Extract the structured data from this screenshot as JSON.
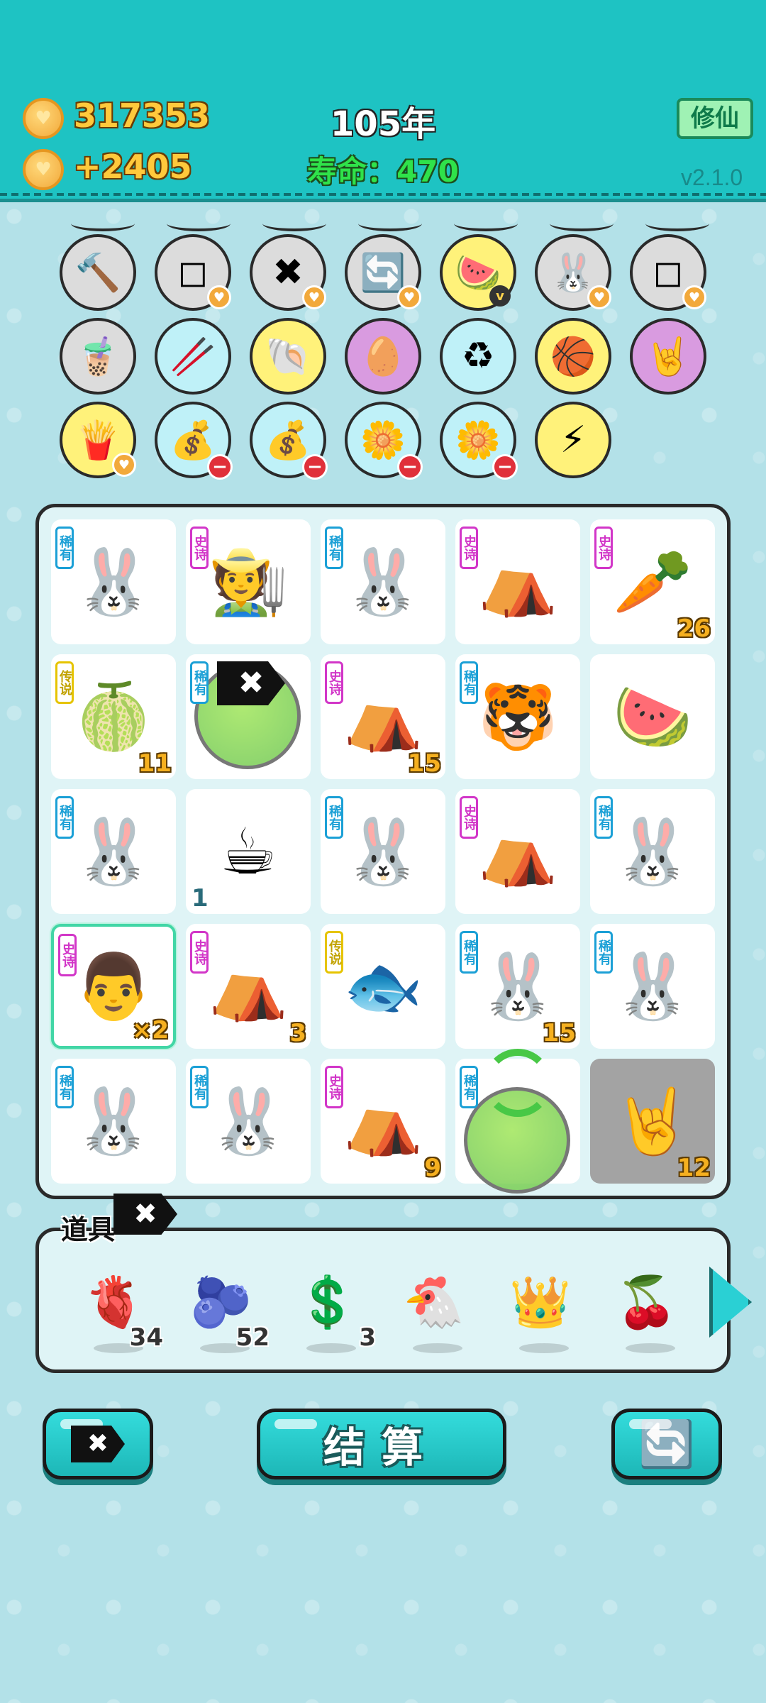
{
  "header": {
    "coins": "317353",
    "coins_per_turn": "+2405",
    "year": "105年",
    "lifespan": "寿命：470",
    "xiuxian_button": "修仙",
    "version": "v2.1.0"
  },
  "round_items": [
    {
      "name": "hammer-icon",
      "glyph": "🔨",
      "color": "gray"
    },
    {
      "name": "sugar-cubes-icon",
      "glyph": "◻",
      "color": "gray",
      "badge": "heart"
    },
    {
      "name": "remove-tag-icon",
      "glyph": "✖",
      "color": "gray",
      "badge": "heart"
    },
    {
      "name": "reroll-icon",
      "glyph": "🔄",
      "color": "gray",
      "badge": "heart"
    },
    {
      "name": "fruit-basket-icon",
      "glyph": "🍉",
      "color": "yellow",
      "badge": "v"
    },
    {
      "name": "rabbit-icon",
      "glyph": "🐰",
      "color": "gray",
      "badge": "heart"
    },
    {
      "name": "sugar-cubes-icon",
      "glyph": "◻",
      "color": "gray",
      "badge": "heart"
    },
    {
      "name": "milk-tea-icon",
      "glyph": "🧋",
      "color": "gray"
    },
    {
      "name": "chopsticks-icon",
      "glyph": "🥢",
      "color": "blue"
    },
    {
      "name": "shell-icon",
      "glyph": "🐚",
      "color": "yellow"
    },
    {
      "name": "fried-egg-icon",
      "glyph": "🥚",
      "color": "purple"
    },
    {
      "name": "recycle-bag-icon",
      "glyph": "♻",
      "color": "blue"
    },
    {
      "name": "basketballs-icon",
      "glyph": "🏀",
      "color": "yellow"
    },
    {
      "name": "rock-hand-icon",
      "glyph": "🤘",
      "color": "purple"
    },
    {
      "name": "fries-icon",
      "glyph": "🍟",
      "color": "yellow",
      "badge": "heart"
    },
    {
      "name": "money-bag-icon",
      "glyph": "💰",
      "color": "blue",
      "badge": "minus"
    },
    {
      "name": "money-bag-icon",
      "glyph": "💰",
      "color": "blue",
      "badge": "minus"
    },
    {
      "name": "potted-flower-icon",
      "glyph": "🌼",
      "color": "blue",
      "badge": "minus"
    },
    {
      "name": "potted-flower-icon",
      "glyph": "🌼",
      "color": "blue",
      "badge": "minus"
    },
    {
      "name": "lightning-icon",
      "glyph": "⚡",
      "color": "yellow"
    }
  ],
  "grid": [
    {
      "icon": "rabbit-icon",
      "glyph": "🐰",
      "tag": "稀有",
      "tag_color": "blue",
      "count": ""
    },
    {
      "icon": "farmer-face-icon",
      "glyph": "🧑‍🌾",
      "tag": "史诗",
      "tag_color": "pink",
      "count": ""
    },
    {
      "icon": "rabbit-icon",
      "glyph": "🐰",
      "tag": "稀有",
      "tag_color": "blue",
      "count": ""
    },
    {
      "icon": "rabbit-tent-icon",
      "glyph": "⛺",
      "tag": "史诗",
      "tag_color": "pink",
      "count": ""
    },
    {
      "icon": "carrot-icon",
      "glyph": "🥕",
      "tag": "史诗",
      "tag_color": "pink",
      "count": "26"
    },
    {
      "icon": "watermelon-icon",
      "glyph": "🍈",
      "tag": "传说",
      "tag_color": "yellow",
      "count": "11"
    },
    {
      "icon": "bubble-removed-icon",
      "glyph": "",
      "tag": "稀有",
      "tag_color": "blue",
      "count": "",
      "special": "remove"
    },
    {
      "icon": "rabbit-tent-icon",
      "glyph": "⛺",
      "tag": "史诗",
      "tag_color": "pink",
      "count": "15"
    },
    {
      "icon": "tiger-icon",
      "glyph": "🐯",
      "tag": "稀有",
      "tag_color": "blue",
      "count": ""
    },
    {
      "icon": "watermelon-slice-icon",
      "glyph": "🍉",
      "tag": "",
      "tag_color": "",
      "count": ""
    },
    {
      "icon": "rabbit-icon",
      "glyph": "🐰",
      "tag": "稀有",
      "tag_color": "blue",
      "count": ""
    },
    {
      "icon": "coffee-icon",
      "glyph": "☕",
      "tag": "",
      "tag_color": "",
      "count": "1",
      "count_left": true
    },
    {
      "icon": "rabbit-icon",
      "glyph": "🐰",
      "tag": "稀有",
      "tag_color": "blue",
      "count": ""
    },
    {
      "icon": "rabbit-tent-icon",
      "glyph": "⛺",
      "tag": "史诗",
      "tag_color": "pink",
      "count": ""
    },
    {
      "icon": "rabbit-icon",
      "glyph": "🐰",
      "tag": "稀有",
      "tag_color": "blue",
      "count": ""
    },
    {
      "icon": "man-face-icon",
      "glyph": "👨",
      "tag": "史诗",
      "tag_color": "pink",
      "count": "×2",
      "highlight": true
    },
    {
      "icon": "rabbit-tent-icon",
      "glyph": "⛺",
      "tag": "史诗",
      "tag_color": "pink",
      "count": "3"
    },
    {
      "icon": "koi-fish-icon",
      "glyph": "🐟",
      "tag": "传说",
      "tag_color": "yellow",
      "count": ""
    },
    {
      "icon": "rabbit-icon",
      "glyph": "🐰",
      "tag": "稀有",
      "tag_color": "blue",
      "count": "15"
    },
    {
      "icon": "rabbit-icon",
      "glyph": "🐰",
      "tag": "稀有",
      "tag_color": "blue",
      "count": ""
    },
    {
      "icon": "rabbit-icon",
      "glyph": "🐰",
      "tag": "稀有",
      "tag_color": "blue",
      "count": ""
    },
    {
      "icon": "rabbit-icon",
      "glyph": "🐰",
      "tag": "稀有",
      "tag_color": "blue",
      "count": ""
    },
    {
      "icon": "rabbit-tent-icon",
      "glyph": "⛺",
      "tag": "史诗",
      "tag_color": "pink",
      "count": "9"
    },
    {
      "icon": "bubble-reroll-icon",
      "glyph": "",
      "tag": "稀有",
      "tag_color": "blue",
      "count": "",
      "special": "reroll"
    },
    {
      "icon": "rock-hand-icon",
      "glyph": "🤘",
      "tag": "",
      "tag_color": "",
      "count": "12",
      "grayed": true
    }
  ],
  "tools": {
    "title": "道具",
    "items": [
      {
        "icon": "liver-icon",
        "glyph": "🫀",
        "count": "34"
      },
      {
        "icon": "blueberry-icon",
        "glyph": "🫐",
        "count": "52"
      },
      {
        "icon": "dollar-coin-icon",
        "glyph": "💲",
        "count": "3"
      },
      {
        "icon": "chicken-icon",
        "glyph": "🐔",
        "count": ""
      },
      {
        "icon": "crown-icon",
        "glyph": "👑",
        "count": ""
      },
      {
        "icon": "lychee-icon",
        "glyph": "🍒",
        "count": ""
      }
    ]
  },
  "buttons": {
    "remove": "✖",
    "settle": "结算",
    "refresh": "🔄"
  }
}
